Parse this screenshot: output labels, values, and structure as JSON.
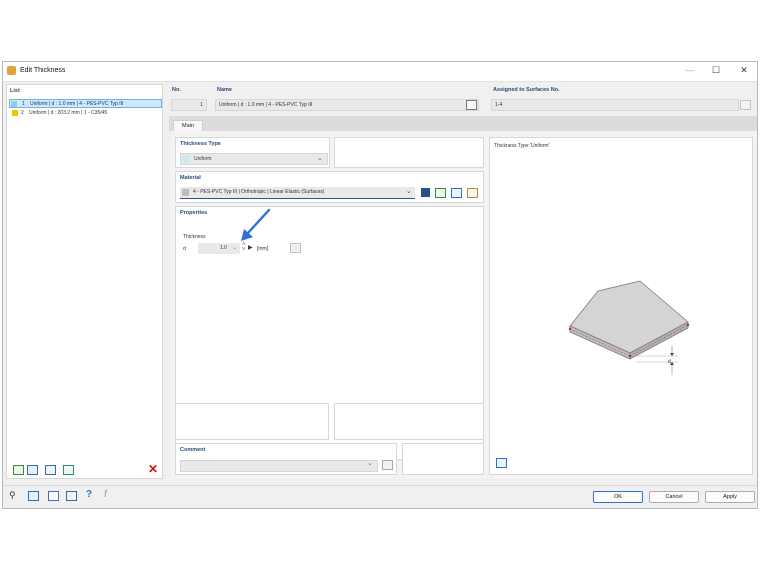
{
  "window": {
    "title": "Edit Thickness",
    "minimize": "—",
    "maximize": "☐",
    "close": "✕"
  },
  "list": {
    "header": "List",
    "items": [
      {
        "no": "1",
        "text": "Uniform | d : 1.0 mm | 4 - PES-PVC Typ III",
        "color": "#8fd0e8",
        "selected": true
      },
      {
        "no": "2",
        "text": "Uniform | d : 203.2 mm | 1 - C35/45",
        "color": "#f5c400",
        "selected": false
      }
    ]
  },
  "header_fields": {
    "no_label": "No.",
    "no_value": "1",
    "name_label": "Name",
    "name_value": "Uniform | d : 1.0 mm | 4 - PES-PVC Typ III",
    "assigned_label": "Assigned to Surfaces No.",
    "assigned_value": "1-4"
  },
  "tabs": [
    {
      "label": "Main"
    }
  ],
  "thickness_type": {
    "label": "Thickness Type",
    "value": "Uniform"
  },
  "material": {
    "label": "Material",
    "value": "4 - PES-PVC Typ III | Orthotropic | Linear Elastic (Surfaces)"
  },
  "properties": {
    "label": "Properties",
    "thickness_label": "Thickness",
    "symbol": "d",
    "value": "1.0",
    "unit": "[mm]"
  },
  "preview": {
    "title": "Thickness Type  'Uniform'",
    "dim_label": "d"
  },
  "comment": {
    "label": "Comment",
    "value": ""
  },
  "buttons": {
    "ok": "OK",
    "cancel": "Cancel",
    "apply": "Apply"
  },
  "colors": {
    "accent_blue": "#2f6fd6",
    "header_label": "#2b4a7a",
    "selection": "#cde8ff",
    "delete_red": "#cc1111"
  }
}
